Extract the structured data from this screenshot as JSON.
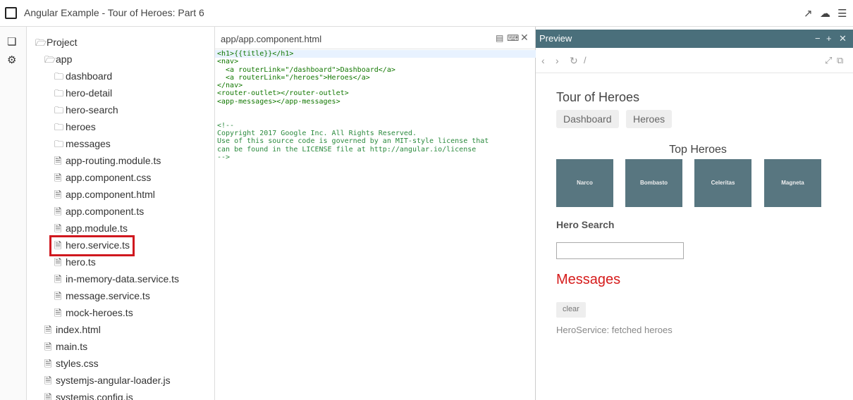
{
  "window": {
    "title": "Angular Example - Tour of Heroes: Part 6"
  },
  "tree": {
    "root": "Project",
    "app_folder": "app",
    "folders": [
      "dashboard",
      "hero-detail",
      "hero-search",
      "heroes",
      "messages"
    ],
    "app_files": [
      "app-routing.module.ts",
      "app.component.css",
      "app.component.html",
      "app.component.ts",
      "app.module.ts",
      "hero.service.ts",
      "hero.ts",
      "in-memory-data.service.ts",
      "message.service.ts",
      "mock-heroes.ts"
    ],
    "root_files": [
      "index.html",
      "main.ts",
      "styles.css",
      "systemjs-angular-loader.js",
      "systemjs.config.js"
    ],
    "highlighted": "hero.service.ts"
  },
  "editor": {
    "filename": "app/app.component.html",
    "lines": [
      "<h1>{{title}}</h1>",
      "<nav>",
      "  <a routerLink=\"/dashboard\">Dashboard</a>",
      "  <a routerLink=\"/heroes\">Heroes</a>",
      "</nav>",
      "<router-outlet></router-outlet>",
      "<app-messages></app-messages>",
      "",
      "",
      "<!--",
      "Copyright 2017 Google Inc. All Rights Reserved.",
      "Use of this source code is governed by an MIT-style license that",
      "can be found in the LICENSE file at http://angular.io/license",
      "-->"
    ]
  },
  "preview": {
    "header": "Preview",
    "url": "/",
    "app": {
      "title": "Tour of Heroes",
      "nav": [
        "Dashboard",
        "Heroes"
      ],
      "top_heroes_heading": "Top Heroes",
      "heroes": [
        "Narco",
        "Bombasto",
        "Celeritas",
        "Magneta"
      ],
      "hero_search_label": "Hero Search",
      "search_value": "",
      "messages_heading": "Messages",
      "clear_button": "clear",
      "messages": [
        "HeroService: fetched heroes"
      ]
    }
  },
  "colors": {
    "highlight_border": "#d0181f",
    "preview_header": "#4a6f7b",
    "tile": "#587680",
    "messages_heading": "#d61b1b"
  }
}
